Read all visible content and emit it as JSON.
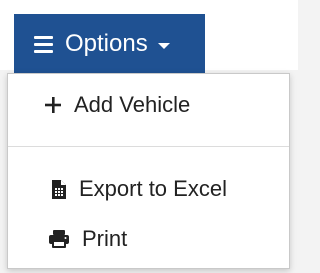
{
  "options_button": {
    "label": "Options",
    "icon": "hamburger-menu-icon",
    "caret_icon": "caret-down-icon",
    "background": "#1f5192",
    "text_color": "#ffffff"
  },
  "menu": {
    "items": [
      {
        "label": "Add Vehicle",
        "icon": "plus-icon"
      },
      {
        "label": "Export to Excel",
        "icon": "spreadsheet-file-icon"
      },
      {
        "label": "Print",
        "icon": "printer-icon"
      }
    ]
  }
}
